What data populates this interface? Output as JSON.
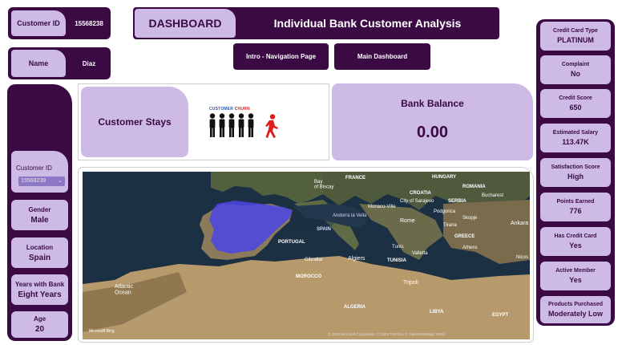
{
  "header": {
    "dashboard_label": "DASHBOARD",
    "title": "Individual Bank Customer Analysis",
    "nav": [
      "Intro - Navigation Page",
      "Main Dashboard"
    ]
  },
  "customer": {
    "id_label": "Customer ID",
    "id_value": "15568238",
    "name_label": "Name",
    "name_value": "Diaz"
  },
  "filter": {
    "label": "Customer ID",
    "selected": "15568238"
  },
  "left_stats": [
    {
      "label": "Gender",
      "value": "Male"
    },
    {
      "label": "Location",
      "value": "Spain"
    },
    {
      "label": "Years with Bank",
      "value": "Eight Years"
    },
    {
      "label": "Age",
      "value": "20"
    }
  ],
  "churn": {
    "status": "Customer Stays",
    "legend_a": "CUSTOMER",
    "legend_b": "CHURN"
  },
  "balance": {
    "label": "Bank Balance",
    "value": "0.00"
  },
  "right_stats": [
    {
      "label": "Credit Card Type",
      "value": "PLATINUM"
    },
    {
      "label": "Complaint",
      "value": "No"
    },
    {
      "label": "Credit Score",
      "value": "650"
    },
    {
      "label": "Estimated Salary",
      "value": "113.47K"
    },
    {
      "label": "Satisfaction Score",
      "value": "High"
    },
    {
      "label": "Points Earned",
      "value": "776"
    },
    {
      "label": "Has Credit Card",
      "value": "Yes"
    },
    {
      "label": "Active Member",
      "value": "Yes"
    },
    {
      "label": "Products Purchased",
      "value": "Moderately Low"
    }
  ],
  "map": {
    "labels": {
      "france": "FRANCE",
      "hungary": "HUNGARY",
      "romania": "ROMANIA",
      "bay": "Bay\nof Biscay",
      "monaco": "Monaco-Ville",
      "croatia": "CROATIA",
      "sarajevo": "City of Sarajevo",
      "serbia": "SERBIA",
      "bucharest": "Bucharest",
      "spain": "SPAIN",
      "andorra": "Andorra la Vella",
      "rome": "Rome",
      "podgorica": "Podgorica",
      "skopje": "Skopje",
      "tirana": "Tirana",
      "ankara": "Ankara",
      "portugal": "PORTUGAL",
      "greece": "GREECE",
      "tunis": "Tunis",
      "athens": "Athens",
      "gibraltar": "Gibraltar",
      "algiers": "Algiers",
      "tunisia": "TUNISIA",
      "valletta": "Valletta",
      "nicosia": "Nicos",
      "morocco": "MOROCCO",
      "tripoli": "Tripoli",
      "atlantic": "Atlantic\nOcean",
      "algeria": "ALGERIA",
      "libya": "LIBYA",
      "egypt": "EGYPT",
      "logo": "Microsoft Bing",
      "copyright": "© 2024 Microsoft Corporation, © 2024 TomTom, © OpenStreetMap  Terms"
    }
  },
  "colors": {
    "dark": "#3b0a45",
    "lilac": "#cdbbe6",
    "highlight": "#4b45e6"
  }
}
